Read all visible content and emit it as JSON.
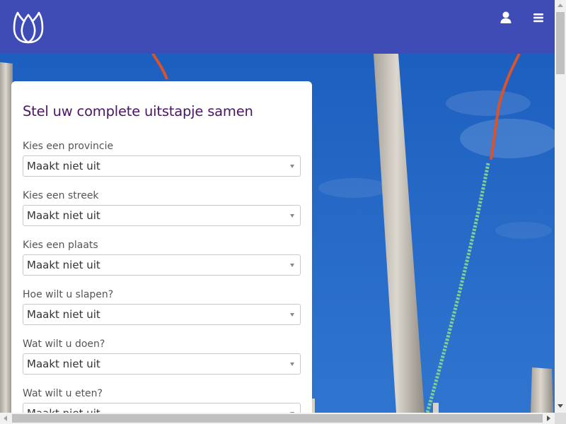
{
  "header": {
    "logo_icon": "tulip-logo-icon",
    "user_icon": "user-icon",
    "menu_icon": "hamburger-menu-icon",
    "background_color": "#3f4cb6"
  },
  "hero": {
    "image": "wooden-poles-with-ropes-blue-sky"
  },
  "form": {
    "title": "Stel uw complete uitstapje samen",
    "title_color": "#4b1566",
    "fields": [
      {
        "label": "Kies een provincie",
        "value": "Maakt niet uit"
      },
      {
        "label": "Kies een streek",
        "value": "Maakt niet uit"
      },
      {
        "label": "Kies een plaats",
        "value": "Maakt niet uit"
      },
      {
        "label": "Hoe wilt u slapen?",
        "value": "Maakt niet uit"
      },
      {
        "label": "Wat wilt u doen?",
        "value": "Maakt niet uit"
      },
      {
        "label": "Wat wilt u eten?",
        "value": "Maakt niet uit"
      }
    ]
  }
}
